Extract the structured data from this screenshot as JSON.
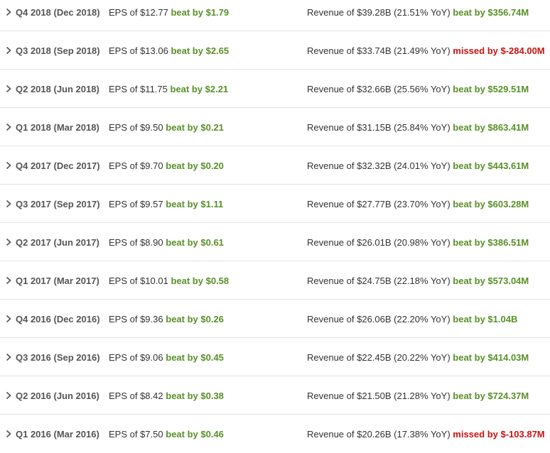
{
  "colors": {
    "beat": "#5a8f29",
    "missed": "#cc1111",
    "text": "#333333",
    "divider": "#e2e2e2"
  },
  "row_icon": "chevron-right-icon",
  "earnings": [
    {
      "quarter": "Q4 2018 (Dec 2018)",
      "eps_text": "EPS of $12.77",
      "eps_result": "beat by $1.79",
      "eps_status": "beat",
      "revenue_text": "Revenue of $39.28B (21.51% YoY)",
      "revenue_result": "beat by $356.74M",
      "revenue_status": "beat"
    },
    {
      "quarter": "Q3 2018 (Sep 2018)",
      "eps_text": "EPS of $13.06",
      "eps_result": "beat by $2.65",
      "eps_status": "beat",
      "revenue_text": "Revenue of $33.74B (21.49% YoY)",
      "revenue_result": "missed by $-284.00M",
      "revenue_status": "missed"
    },
    {
      "quarter": "Q2 2018 (Jun 2018)",
      "eps_text": "EPS of $11.75",
      "eps_result": "beat by $2.21",
      "eps_status": "beat",
      "revenue_text": "Revenue of $32.66B (25.56% YoY)",
      "revenue_result": "beat by $529.51M",
      "revenue_status": "beat"
    },
    {
      "quarter": "Q1 2018 (Mar 2018)",
      "eps_text": "EPS of $9.50",
      "eps_result": "beat by $0.21",
      "eps_status": "beat",
      "revenue_text": "Revenue of $31.15B (25.84% YoY)",
      "revenue_result": "beat by $863.41M",
      "revenue_status": "beat"
    },
    {
      "quarter": "Q4 2017 (Dec 2017)",
      "eps_text": "EPS of $9.70",
      "eps_result": "beat by $0.20",
      "eps_status": "beat",
      "revenue_text": "Revenue of $32.32B (24.01% YoY)",
      "revenue_result": "beat by $443.61M",
      "revenue_status": "beat"
    },
    {
      "quarter": "Q3 2017 (Sep 2017)",
      "eps_text": "EPS of $9.57",
      "eps_result": "beat by $1.11",
      "eps_status": "beat",
      "revenue_text": "Revenue of $27.77B (23.70% YoY)",
      "revenue_result": "beat by $603.28M",
      "revenue_status": "beat"
    },
    {
      "quarter": "Q2 2017 (Jun 2017)",
      "eps_text": "EPS of $8.90",
      "eps_result": "beat by $0.61",
      "eps_status": "beat",
      "revenue_text": "Revenue of $26.01B (20.98% YoY)",
      "revenue_result": "beat by $386.51M",
      "revenue_status": "beat"
    },
    {
      "quarter": "Q1 2017 (Mar 2017)",
      "eps_text": "EPS of $10.01",
      "eps_result": "beat by $0.58",
      "eps_status": "beat",
      "revenue_text": "Revenue of $24.75B (22.18% YoY)",
      "revenue_result": "beat by $573.04M",
      "revenue_status": "beat"
    },
    {
      "quarter": "Q4 2016 (Dec 2016)",
      "eps_text": "EPS of $9.36",
      "eps_result": "beat by $0.26",
      "eps_status": "beat",
      "revenue_text": "Revenue of $26.06B (22.20% YoY)",
      "revenue_result": "beat by $1.04B",
      "revenue_status": "beat"
    },
    {
      "quarter": "Q3 2016 (Sep 2016)",
      "eps_text": "EPS of $9.06",
      "eps_result": "beat by $0.45",
      "eps_status": "beat",
      "revenue_text": "Revenue of $22.45B (20.22% YoY)",
      "revenue_result": "beat by $414.03M",
      "revenue_status": "beat"
    },
    {
      "quarter": "Q2 2016 (Jun 2016)",
      "eps_text": "EPS of $8.42",
      "eps_result": "beat by $0.38",
      "eps_status": "beat",
      "revenue_text": "Revenue of $21.50B (21.28% YoY)",
      "revenue_result": "beat by $724.37M",
      "revenue_status": "beat"
    },
    {
      "quarter": "Q1 2016 (Mar 2016)",
      "eps_text": "EPS of $7.50",
      "eps_result": "beat by $0.46",
      "eps_status": "beat",
      "revenue_text": "Revenue of $20.26B (17.38% YoY)",
      "revenue_result": "missed by $-103.87M",
      "revenue_status": "missed"
    }
  ]
}
